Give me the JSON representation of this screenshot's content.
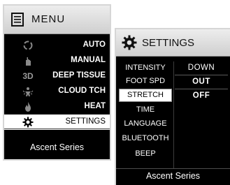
{
  "menu": {
    "title": "MENU",
    "icon": "menu-list-icon",
    "items": [
      {
        "label": "AUTO",
        "icon": "auto-cycle-icon"
      },
      {
        "label": "MANUAL",
        "icon": "manual-hand-icon"
      },
      {
        "label": "DEEP TISSUE",
        "icon_text": "3D",
        "icon": "3d-icon"
      },
      {
        "label": "CLOUD TCH",
        "icon": "cloud-touch-icon"
      },
      {
        "label": "HEAT",
        "icon": "flame-icon"
      },
      {
        "label": "SETTINGS",
        "icon": "gear-icon",
        "selected": true
      }
    ],
    "footer": "Ascent Series"
  },
  "settings": {
    "title": "SETTINGS",
    "icon": "gear-icon",
    "items": [
      {
        "label": "INTENSITY"
      },
      {
        "label": "FOOT SPD"
      },
      {
        "label": "STRETCH",
        "selected": true
      },
      {
        "label": "TIME"
      },
      {
        "label": "LANGUAGE"
      },
      {
        "label": "BLUETOOTH"
      },
      {
        "label": "BEEP"
      }
    ],
    "options": [
      "DOWN",
      "OUT",
      "OFF"
    ],
    "footer": "Ascent Series"
  },
  "colors": {
    "screen_bg": "#000000",
    "header_bg": "#dcdcdc",
    "highlight": "#ffffff",
    "icon_gray": "#9a9a9a"
  }
}
